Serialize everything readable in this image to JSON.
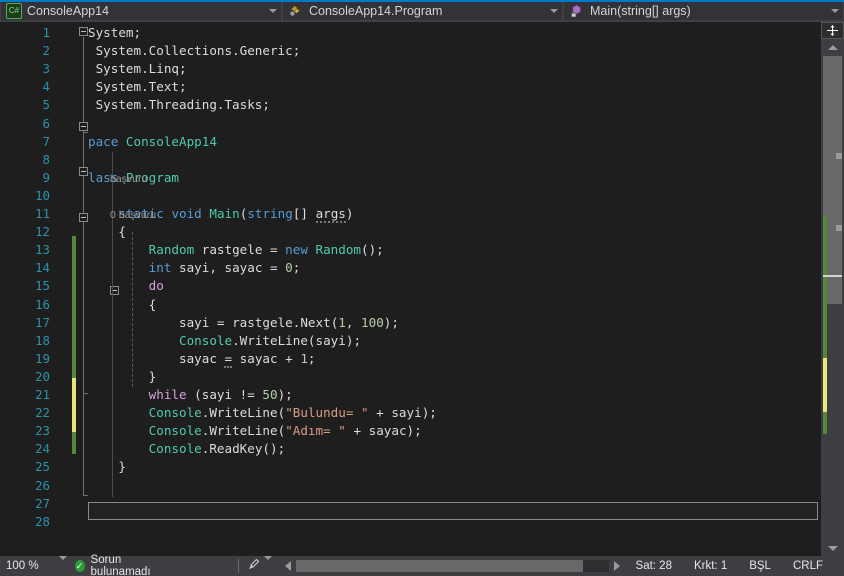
{
  "navbar": {
    "project": {
      "label": "ConsoleApp14",
      "icon": "csharp-project-icon"
    },
    "type": {
      "label": "ConsoleApp14.Program",
      "icon": "class-icon"
    },
    "member": {
      "label": "Main(string[] args)",
      "icon": "method-private-icon"
    }
  },
  "editor": {
    "lines": [
      {
        "n": "1",
        "tokens": [
          {
            "t": "System;",
            "c": "id"
          }
        ]
      },
      {
        "n": "2",
        "tokens": [
          {
            "t": " System.Collections.Generic;",
            "c": "id"
          }
        ]
      },
      {
        "n": "3",
        "tokens": [
          {
            "t": " System.Linq;",
            "c": "id"
          }
        ]
      },
      {
        "n": "4",
        "tokens": [
          {
            "t": " System.Text;",
            "c": "id"
          }
        ]
      },
      {
        "n": "5",
        "tokens": [
          {
            "t": " System.Threading.Tasks;",
            "c": "id"
          }
        ]
      },
      {
        "n": "6",
        "tokens": []
      },
      {
        "n": "7",
        "tokens": [
          {
            "t": "pace ",
            "c": "kw"
          },
          {
            "t": "ConsoleApp14",
            "c": "type"
          }
        ]
      },
      {
        "n": "8",
        "tokens": []
      },
      {
        "n": "9",
        "tokens": [
          {
            "t": "lass ",
            "c": "kw"
          },
          {
            "t": "Program",
            "c": "type"
          }
        ]
      },
      {
        "n": "10",
        "tokens": []
      },
      {
        "n": "11",
        "tokens": [
          {
            "t": "    ",
            "c": "plain"
          },
          {
            "t": "static",
            "c": "kw"
          },
          {
            "t": " ",
            "c": "plain"
          },
          {
            "t": "void",
            "c": "kw"
          },
          {
            "t": " ",
            "c": "plain"
          },
          {
            "t": "Main",
            "c": "type"
          },
          {
            "t": "(",
            "c": "punc"
          },
          {
            "t": "string",
            "c": "kw"
          },
          {
            "t": "[] ",
            "c": "punc"
          },
          {
            "t": "args",
            "c": "sugg"
          },
          {
            "t": ")",
            "c": "punc"
          }
        ]
      },
      {
        "n": "12",
        "tokens": [
          {
            "t": "    {",
            "c": "punc"
          }
        ]
      },
      {
        "n": "13",
        "tokens": [
          {
            "t": "        ",
            "c": "plain"
          },
          {
            "t": "Random",
            "c": "type"
          },
          {
            "t": " rastgele ",
            "c": "id"
          },
          {
            "t": "= ",
            "c": "punc"
          },
          {
            "t": "new",
            "c": "kw"
          },
          {
            "t": " ",
            "c": "plain"
          },
          {
            "t": "Random",
            "c": "type"
          },
          {
            "t": "();",
            "c": "punc"
          }
        ]
      },
      {
        "n": "14",
        "tokens": [
          {
            "t": "        ",
            "c": "plain"
          },
          {
            "t": "int",
            "c": "kw"
          },
          {
            "t": " sayi, sayac ",
            "c": "id"
          },
          {
            "t": "= ",
            "c": "punc"
          },
          {
            "t": "0",
            "c": "num"
          },
          {
            "t": ";",
            "c": "punc"
          }
        ]
      },
      {
        "n": "15",
        "tokens": [
          {
            "t": "        ",
            "c": "plain"
          },
          {
            "t": "do",
            "c": "kwc"
          }
        ]
      },
      {
        "n": "16",
        "tokens": [
          {
            "t": "        {",
            "c": "punc"
          }
        ]
      },
      {
        "n": "17",
        "tokens": [
          {
            "t": "            sayi ",
            "c": "id"
          },
          {
            "t": "= ",
            "c": "punc"
          },
          {
            "t": "rastgele",
            "c": "id"
          },
          {
            "t": ".",
            "c": "punc"
          },
          {
            "t": "Next",
            "c": "plain"
          },
          {
            "t": "(",
            "c": "punc"
          },
          {
            "t": "1",
            "c": "num"
          },
          {
            "t": ", ",
            "c": "punc"
          },
          {
            "t": "100",
            "c": "num"
          },
          {
            "t": ");",
            "c": "punc"
          }
        ]
      },
      {
        "n": "18",
        "tokens": [
          {
            "t": "            ",
            "c": "plain"
          },
          {
            "t": "Console",
            "c": "type"
          },
          {
            "t": ".",
            "c": "punc"
          },
          {
            "t": "WriteLine",
            "c": "plain"
          },
          {
            "t": "(",
            "c": "punc"
          },
          {
            "t": "sayi",
            "c": "id"
          },
          {
            "t": ");",
            "c": "punc"
          }
        ]
      },
      {
        "n": "19",
        "tokens": [
          {
            "t": "            sayac ",
            "c": "id"
          },
          {
            "t": "=",
            "c": "sugg"
          },
          {
            "t": " sayac ",
            "c": "id"
          },
          {
            "t": "+ ",
            "c": "punc"
          },
          {
            "t": "1",
            "c": "num"
          },
          {
            "t": ";",
            "c": "punc"
          }
        ]
      },
      {
        "n": "20",
        "tokens": [
          {
            "t": "        }",
            "c": "punc"
          }
        ]
      },
      {
        "n": "21",
        "tokens": [
          {
            "t": "        ",
            "c": "plain"
          },
          {
            "t": "while",
            "c": "kwc"
          },
          {
            "t": " (sayi ",
            "c": "id"
          },
          {
            "t": "!= ",
            "c": "punc"
          },
          {
            "t": "50",
            "c": "num"
          },
          {
            "t": ");",
            "c": "punc"
          }
        ]
      },
      {
        "n": "22",
        "tokens": [
          {
            "t": "        ",
            "c": "plain"
          },
          {
            "t": "Console",
            "c": "type"
          },
          {
            "t": ".",
            "c": "punc"
          },
          {
            "t": "WriteLine",
            "c": "plain"
          },
          {
            "t": "(",
            "c": "punc"
          },
          {
            "t": "\"Bulundu= \"",
            "c": "str"
          },
          {
            "t": " + ",
            "c": "punc"
          },
          {
            "t": "sayi",
            "c": "id"
          },
          {
            "t": ");",
            "c": "punc"
          }
        ]
      },
      {
        "n": "23",
        "tokens": [
          {
            "t": "        ",
            "c": "plain"
          },
          {
            "t": "Console",
            "c": "type"
          },
          {
            "t": ".",
            "c": "punc"
          },
          {
            "t": "WriteLine",
            "c": "plain"
          },
          {
            "t": "(",
            "c": "punc"
          },
          {
            "t": "\"Adım= \"",
            "c": "str"
          },
          {
            "t": " + ",
            "c": "punc"
          },
          {
            "t": "sayac",
            "c": "id"
          },
          {
            "t": ");",
            "c": "punc"
          }
        ]
      },
      {
        "n": "24",
        "tokens": [
          {
            "t": "        ",
            "c": "plain"
          },
          {
            "t": "Console",
            "c": "type"
          },
          {
            "t": ".",
            "c": "punc"
          },
          {
            "t": "ReadKey",
            "c": "plain"
          },
          {
            "t": "();",
            "c": "punc"
          }
        ]
      },
      {
        "n": "25",
        "tokens": [
          {
            "t": "    }",
            "c": "punc"
          }
        ]
      },
      {
        "n": "26",
        "tokens": []
      },
      {
        "n": "27",
        "tokens": []
      },
      {
        "n": "28",
        "tokens": []
      }
    ],
    "codelens": [
      {
        "line": 8,
        "text": "başvuru"
      },
      {
        "line": 10,
        "text": "0 başvuru"
      }
    ]
  },
  "scrollbar": {
    "split_icon": "split-view-icon",
    "up_icon": "scroll-up-arrow-icon",
    "down_icon": "scroll-down-arrow-icon"
  },
  "statusbar": {
    "zoom": "100 %",
    "zoom_caret_icon": "chevron-down-icon",
    "build_status": "Sorun bulunamadı",
    "build_status_icon": "check-circle-icon",
    "brush_icon": "brush-icon",
    "brush_caret_icon": "chevron-down-icon",
    "hscroll_left_icon": "scroll-left-arrow-icon",
    "hscroll_right_icon": "scroll-right-arrow-icon",
    "line": "Sat: 28",
    "column": "Krkt: 1",
    "insert_mode": "BŞL",
    "line_endings": "CRLF"
  },
  "colors": {
    "accent": "#007acc",
    "editor_bg": "#1e1e1e",
    "chrome_bg": "#2d2d30",
    "status_bg": "#3e3e42",
    "line_number": "#2b91af",
    "keyword": "#569cd6",
    "control_keyword": "#d8a0df",
    "type": "#4ec9b0",
    "string": "#d69d85",
    "number": "#b5cea8",
    "identifier": "#dcdcdc",
    "changebar_saved": "#57873a",
    "changebar_unsaved": "#e8e87a",
    "ok_green": "#2a9c3a"
  }
}
